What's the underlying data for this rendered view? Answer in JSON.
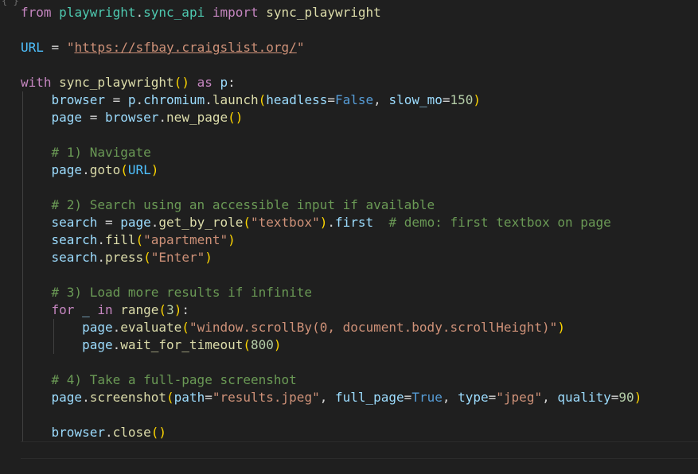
{
  "top_fragment": "{ }",
  "code": {
    "l1": {
      "kw1": "from",
      "mod": "playwright",
      "dot": ".",
      "sub": "sync_api",
      "kw2": "import",
      "fn": "sync_playwright"
    },
    "l3": {
      "name": "URL",
      "eq": " = ",
      "q1": "\"",
      "url": "https://sfbay.craigslist.org/",
      "q2": "\""
    },
    "l5": {
      "kw": "with",
      "fn": "sync_playwright",
      "po": "(",
      "pc": ")",
      "as": "as",
      "var": "p",
      "colon": ":"
    },
    "l6": {
      "var": "browser",
      "eq": " = ",
      "obj": "p",
      "dot1": ".",
      "attr": "chromium",
      "dot2": ".",
      "meth": "launch",
      "po": "(",
      "arg1": "headless",
      "eq2": "=",
      "val1": "False",
      "comma": ", ",
      "arg2": "slow_mo",
      "eq3": "=",
      "val2": "150",
      "pc": ")"
    },
    "l7": {
      "var": "page",
      "eq": " = ",
      "obj": "browser",
      "dot": ".",
      "meth": "new_page",
      "po": "(",
      "pc": ")"
    },
    "l9": {
      "comment": "# 1) Navigate"
    },
    "l10": {
      "obj": "page",
      "dot": ".",
      "meth": "goto",
      "po": "(",
      "arg": "URL",
      "pc": ")"
    },
    "l12": {
      "comment": "# 2) Search using an accessible input if available"
    },
    "l13": {
      "var": "search",
      "eq": " = ",
      "obj": "page",
      "dot1": ".",
      "meth": "get_by_role",
      "po": "(",
      "str": "\"textbox\"",
      "pc": ")",
      "dot2": ".",
      "attr": "first",
      "gap": "  ",
      "comment": "# demo: first textbox on page"
    },
    "l14": {
      "obj": "search",
      "dot": ".",
      "meth": "fill",
      "po": "(",
      "str": "\"apartment\"",
      "pc": ")"
    },
    "l15": {
      "obj": "search",
      "dot": ".",
      "meth": "press",
      "po": "(",
      "str": "\"Enter\"",
      "pc": ")"
    },
    "l17": {
      "comment": "# 3) Load more results if infinite"
    },
    "l18": {
      "kw": "for",
      "us": " _ ",
      "in": "in",
      "fn": "range",
      "po": "(",
      "num": "3",
      "pc": ")",
      "colon": ":"
    },
    "l19": {
      "obj": "page",
      "dot": ".",
      "meth": "evaluate",
      "po": "(",
      "str": "\"window.scrollBy(0, document.body.scrollHeight)\"",
      "pc": ")"
    },
    "l20": {
      "obj": "page",
      "dot": ".",
      "meth": "wait_for_timeout",
      "po": "(",
      "num": "800",
      "pc": ")"
    },
    "l22": {
      "comment": "# 4) Take a full-page screenshot"
    },
    "l23": {
      "obj": "page",
      "dot": ".",
      "meth": "screenshot",
      "po": "(",
      "a1": "path",
      "e1": "=",
      "s1": "\"results.jpeg\"",
      "c1": ", ",
      "a2": "full_page",
      "e2": "=",
      "v2": "True",
      "c2": ", ",
      "a3": "type",
      "e3": "=",
      "s3": "\"jpeg\"",
      "c3": ", ",
      "a4": "quality",
      "e4": "=",
      "n4": "90",
      "pc": ")"
    },
    "l25": {
      "obj": "browser",
      "dot": ".",
      "meth": "close",
      "po": "(",
      "pc": ")"
    }
  },
  "colors": {
    "background": "#1f1f1f",
    "keyword_control": "#c586c0",
    "keyword_storage": "#569cd6",
    "function": "#dcdcaa",
    "variable": "#9cdcfe",
    "constant": "#4fc1ff",
    "string": "#ce9178",
    "comment": "#6a9955",
    "number": "#b5cea8",
    "module": "#4ec9b0",
    "bracket_level1": "#ffd700",
    "bracket_level2": "#da70d6"
  }
}
